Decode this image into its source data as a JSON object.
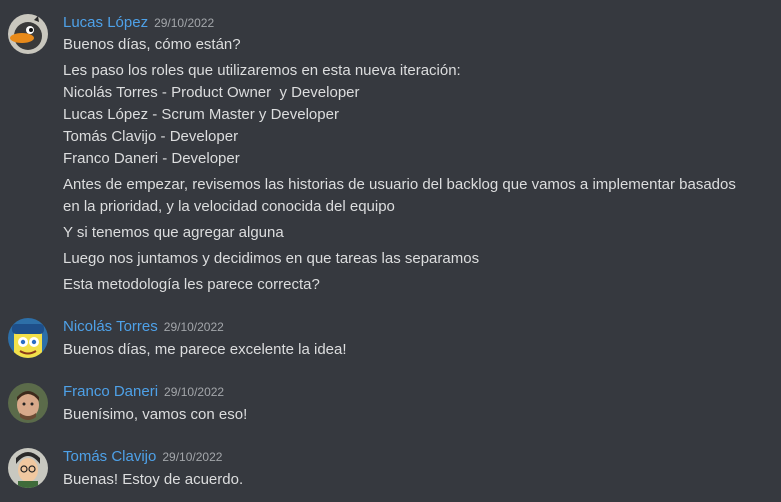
{
  "messages": [
    {
      "author": "Lucas López",
      "timestamp": "29/10/2022",
      "lines": [
        "Buenos días, cómo están?",
        "Les paso los roles que utilizaremos en esta nueva iteración:",
        "Nicolás Torres - Product Owner  y Developer",
        "Lucas López - Scrum Master y Developer",
        "Tomás Clavijo - Developer",
        "Franco Daneri - Developer",
        "Antes de empezar, revisemos las historias de usuario del backlog que vamos a implementar basados en la prioridad, y la velocidad conocida del equipo",
        "Y si tenemos que agregar alguna",
        "Luego nos juntamos y decidimos en que tareas las separamos",
        "Esta metodología les parece correcta?"
      ]
    },
    {
      "author": "Nicolás Torres",
      "timestamp": "29/10/2022",
      "lines": [
        "Buenos días, me parece excelente la idea!"
      ]
    },
    {
      "author": "Franco Daneri",
      "timestamp": "29/10/2022",
      "lines": [
        "Buenísimo, vamos con eso!"
      ]
    },
    {
      "author": "Tomás Clavijo",
      "timestamp": "29/10/2022",
      "lines": [
        "Buenas! Estoy de acuerdo."
      ]
    }
  ],
  "colors": {
    "background": "#36393f",
    "username": "#4ea1e8",
    "text": "#dcddde",
    "timestamp": "#a3a6aa"
  },
  "avatars": [
    "duck-avatar-icon",
    "sponge-avatar-icon",
    "person-avatar-icon",
    "cartoon-avatar-icon"
  ]
}
